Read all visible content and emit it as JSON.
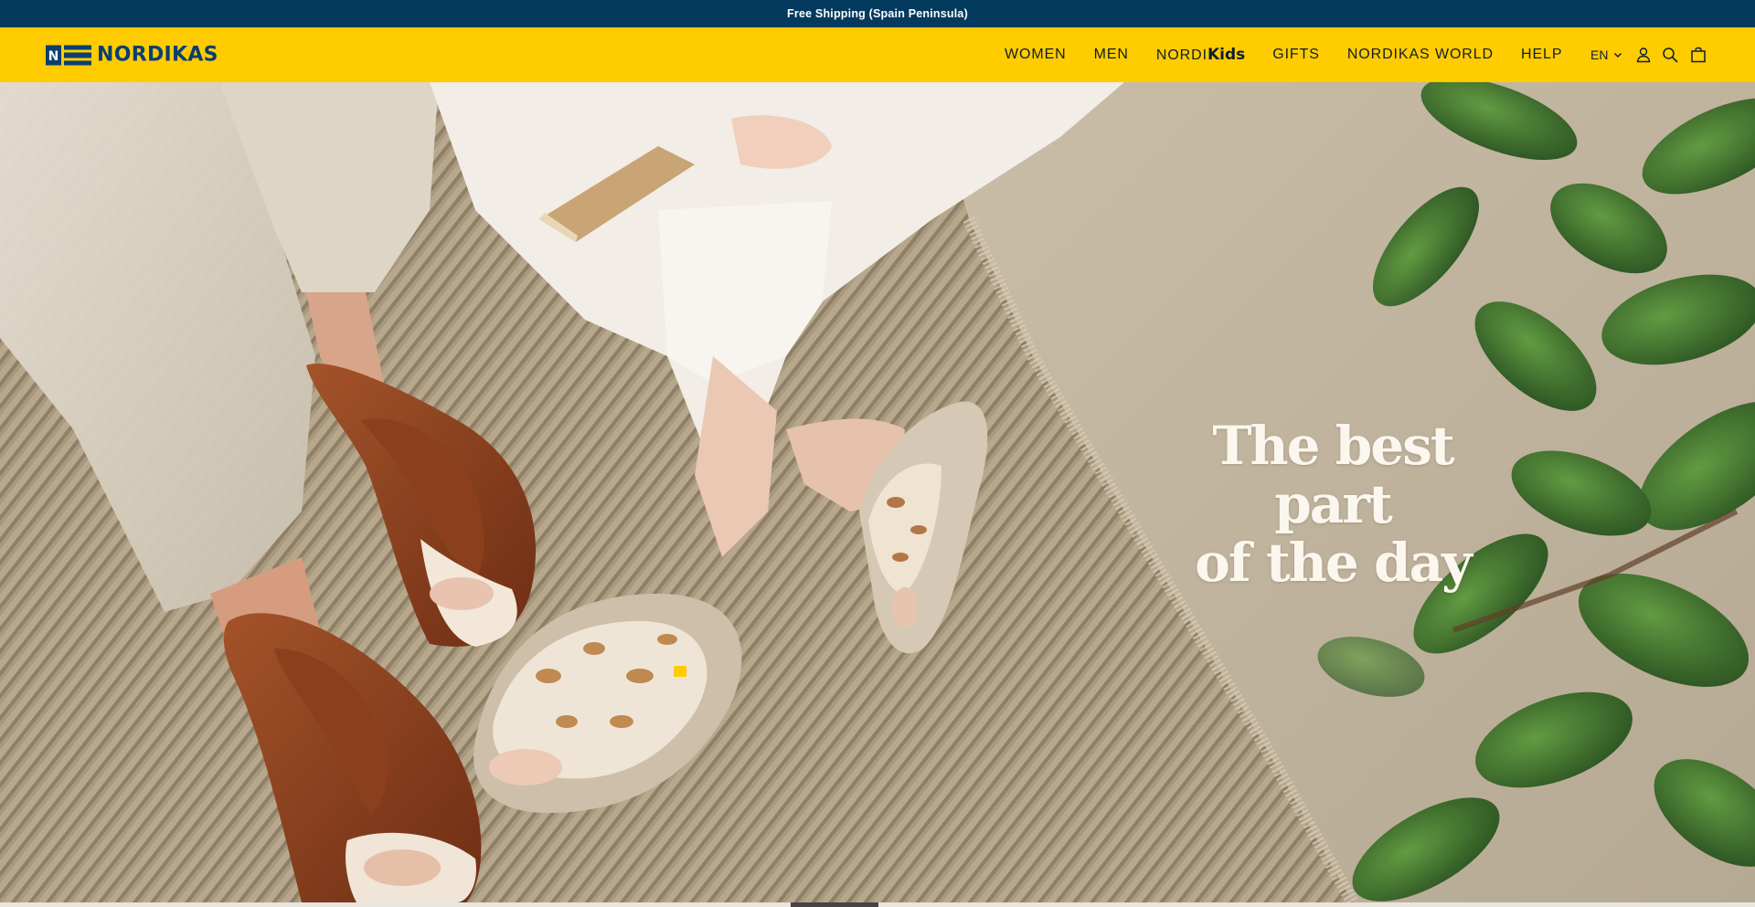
{
  "announcement": {
    "text": "Free Shipping (Spain Peninsula)"
  },
  "header": {
    "logo_text": "NORDIKAS",
    "nav": [
      {
        "label": "WOMEN"
      },
      {
        "label": "MEN"
      },
      {
        "label_prefix": "NORDI",
        "label_suffix": "Kids"
      },
      {
        "label": "GIFTS"
      },
      {
        "label": "NORDIKAS WORLD"
      },
      {
        "label": "HELP"
      }
    ],
    "language": "EN",
    "icons": [
      "account-icon",
      "search-icon",
      "cart-icon"
    ]
  },
  "hero": {
    "title_line1": "The best part",
    "title_line2": "of the day"
  },
  "colors": {
    "announcement_bg": "#033a5e",
    "header_bg": "#ffcc00",
    "brand_blue": "#0a3f70",
    "hero_text": "#fbf6ee"
  }
}
